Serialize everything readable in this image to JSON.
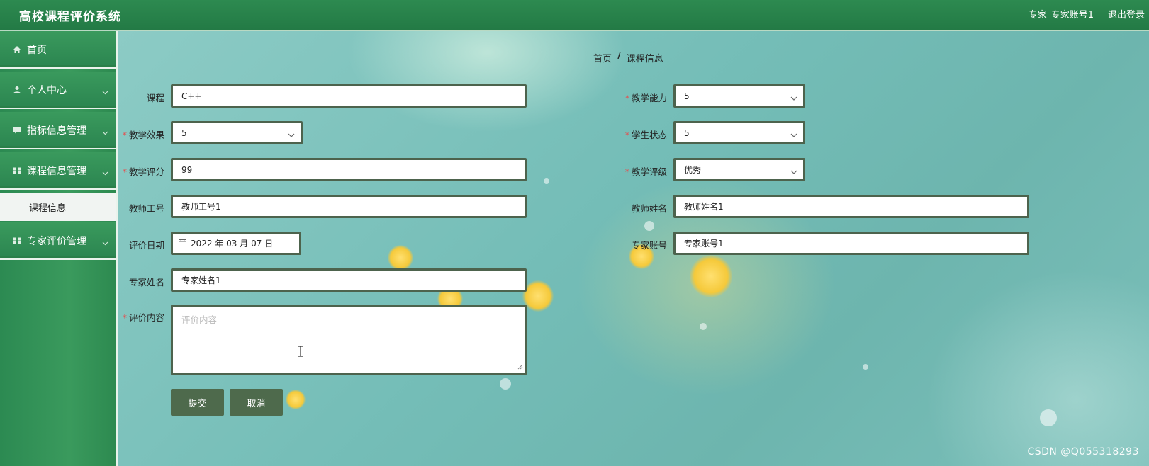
{
  "header": {
    "app_title": "高校课程评价系统",
    "role": "专家",
    "account": "专家账号1",
    "logout": "退出登录"
  },
  "sidebar": {
    "items": [
      {
        "label": "首页",
        "icon": "home-icon"
      },
      {
        "label": "个人中心",
        "icon": "user-icon"
      },
      {
        "label": "指标信息管理",
        "icon": "comment-icon"
      },
      {
        "label": "课程信息管理",
        "icon": "grid-icon"
      },
      {
        "label": "专家评价管理",
        "icon": "grid-icon"
      }
    ],
    "sub_item": "课程信息"
  },
  "breadcrumb": {
    "home": "首页",
    "separator": "/",
    "current": "课程信息"
  },
  "form": {
    "course": {
      "label": "课程",
      "value": "C++"
    },
    "teaching_ability": {
      "label": "教学能力",
      "value": "5"
    },
    "teaching_effect": {
      "label": "教学效果",
      "value": "5"
    },
    "student_state": {
      "label": "学生状态",
      "value": "5"
    },
    "teaching_score": {
      "label": "教学评分",
      "value": "99"
    },
    "teaching_grade": {
      "label": "教学评级",
      "value": "优秀"
    },
    "teacher_id": {
      "label": "教师工号",
      "value": "教师工号1"
    },
    "teacher_name": {
      "label": "教师姓名",
      "value": "教师姓名1"
    },
    "eval_date": {
      "label": "评价日期",
      "value": "2022 年 03 月 07 日"
    },
    "expert_account": {
      "label": "专家账号",
      "value": "专家账号1"
    },
    "expert_name": {
      "label": "专家姓名",
      "value": "专家姓名1"
    },
    "eval_content": {
      "label": "评价内容",
      "placeholder": "评价内容"
    },
    "required_mark": "*"
  },
  "buttons": {
    "submit": "提交",
    "cancel": "取消"
  },
  "watermark": "CSDN @Q055318293",
  "colors": {
    "primary": "#2d8a50",
    "button": "#4e6a4c",
    "required": "#e84b4b"
  }
}
